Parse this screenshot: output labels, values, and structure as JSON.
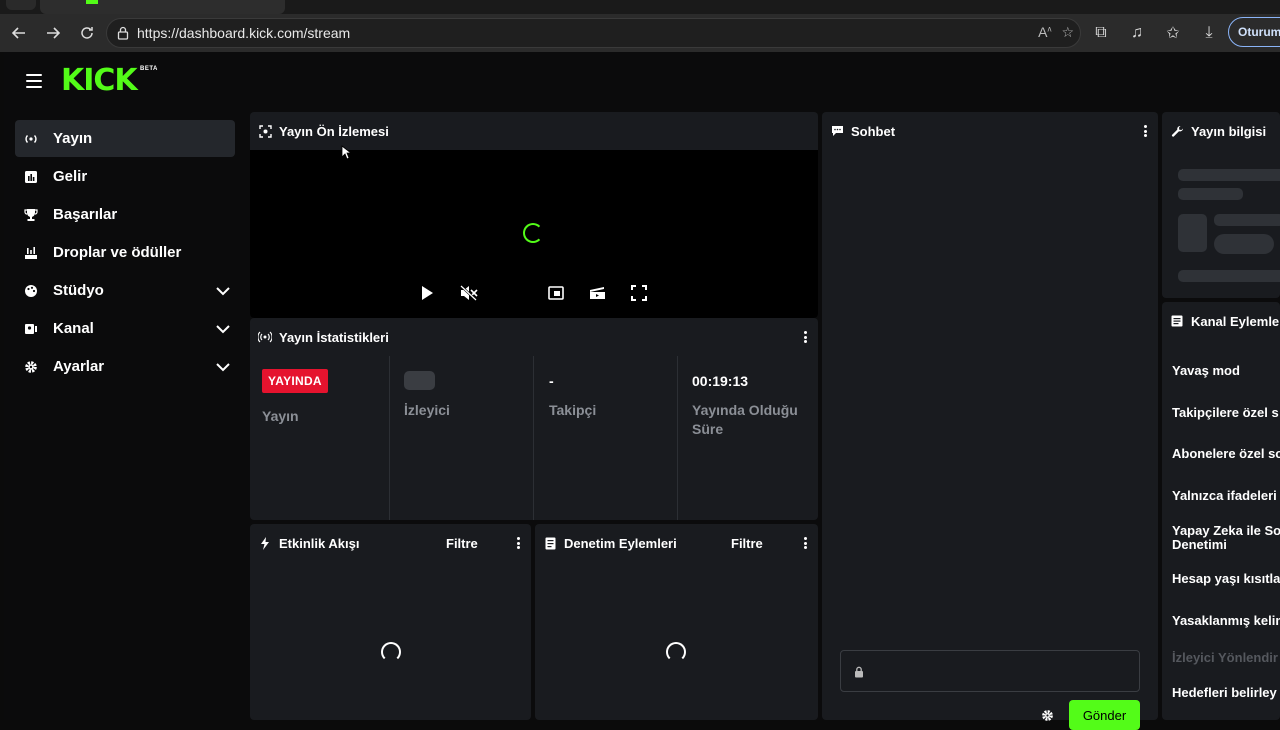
{
  "browser": {
    "url": "https://dashboard.kick.com/stream",
    "signin_label": "Oturum"
  },
  "brand": {
    "logo_text": "KICK",
    "badge": "BETA",
    "accent_color": "#53fc18"
  },
  "sidebar": {
    "items": [
      {
        "label": "Yayın",
        "icon": "broadcast-icon",
        "active": true
      },
      {
        "label": "Gelir",
        "icon": "chart-icon"
      },
      {
        "label": "Başarılar",
        "icon": "trophy-icon"
      },
      {
        "label": "Droplar ve ödüller",
        "icon": "gift-icon"
      },
      {
        "label": "Stüdyo",
        "icon": "palette-icon",
        "expandable": true
      },
      {
        "label": "Kanal",
        "icon": "users-icon",
        "expandable": true
      },
      {
        "label": "Ayarlar",
        "icon": "gear-icon",
        "expandable": true
      }
    ]
  },
  "preview": {
    "title": "Yayın Ön İzlemesi"
  },
  "stats": {
    "title": "Yayın İstatistikleri",
    "live_badge": "YAYINDA",
    "status_label": "Yayın",
    "viewers_label": "İzleyici",
    "followers_value": "-",
    "followers_label": "Takipçi",
    "uptime_value": "00:19:13",
    "uptime_label_1": "Yayında Olduğu",
    "uptime_label_2": "Süre"
  },
  "activity": {
    "title": "Etkinlik Akışı",
    "filter_label": "Filtre"
  },
  "moderation": {
    "title": "Denetim Eylemleri",
    "filter_label": "Filtre"
  },
  "chat": {
    "title": "Sohbet",
    "send_label": "Gönder"
  },
  "stream_info": {
    "title": "Yayın bilgisi"
  },
  "channel_actions": {
    "title": "Kanal Eylemle",
    "items": [
      {
        "label": "Yavaş mod"
      },
      {
        "label": "Takipçilere özel s"
      },
      {
        "label": "Abonelere özel so"
      },
      {
        "label": "Yalnızca ifadeleri"
      },
      {
        "label_1": "Yapay Zeka ile So",
        "label_2": "Denetimi"
      },
      {
        "label": "Hesap yaşı kısıtla"
      },
      {
        "label": "Yasaklanmış kelim"
      },
      {
        "label": "İzleyici Yönlendir",
        "disabled": true
      },
      {
        "label": "Hedefleri belirley"
      }
    ]
  }
}
